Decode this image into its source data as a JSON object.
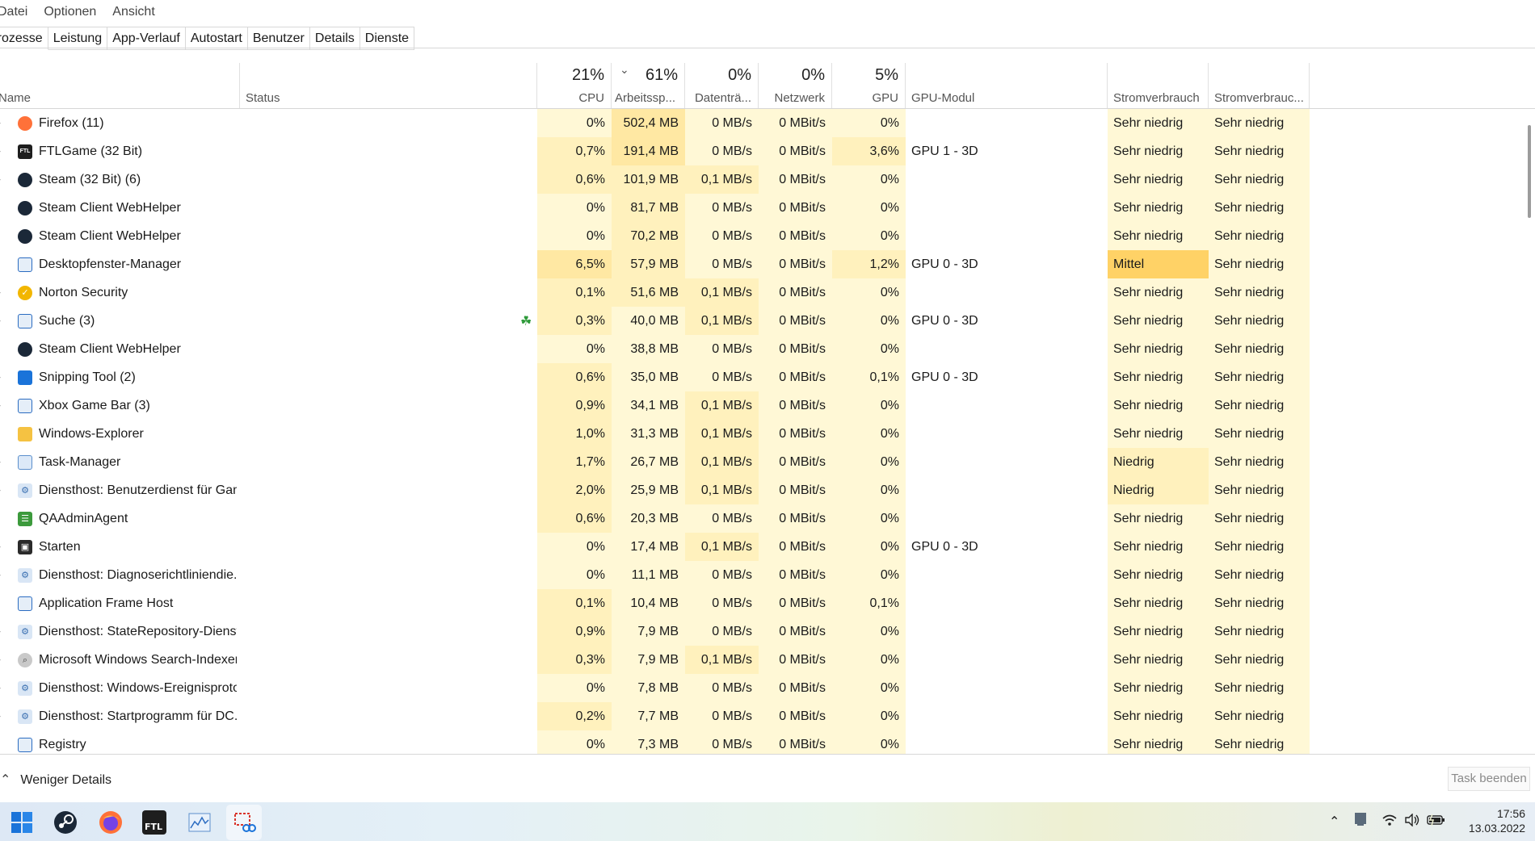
{
  "menu": [
    "Datei",
    "Optionen",
    "Ansicht"
  ],
  "tabs": [
    "Prozesse",
    "Leistung",
    "App-Verlauf",
    "Autostart",
    "Benutzer",
    "Details",
    "Dienste"
  ],
  "header": {
    "name": "Name",
    "status": "Status",
    "cpu_pct": "21%",
    "cpu": "CPU",
    "mem_pct": "61%",
    "mem": "Arbeitssp...",
    "disk_pct": "0%",
    "disk": "Datenträ...",
    "net_pct": "0%",
    "net": "Netzwerk",
    "gpu_pct": "5%",
    "gpu": "GPU",
    "gpu_engine": "GPU-Modul",
    "power": "Stromverbrauch",
    "power_trend": "Stromverbrauc..."
  },
  "processes": [
    {
      "name": "Firefox (11)",
      "icon": "firefox-icon",
      "expand": true,
      "cpu": "0%",
      "mem": "502,4 MB",
      "disk": "0 MB/s",
      "net": "0 MBit/s",
      "gpu": "0%",
      "engine": "",
      "power": "Sehr niedrig",
      "trend": "Sehr niedrig"
    },
    {
      "name": "FTLGame (32 Bit)",
      "icon": "ftl-icon",
      "expand": true,
      "cpu": "0,7%",
      "mem": "191,4 MB",
      "disk": "0 MB/s",
      "net": "0 MBit/s",
      "gpu": "3,6%",
      "engine": "GPU 1 - 3D",
      "power": "Sehr niedrig",
      "trend": "Sehr niedrig"
    },
    {
      "name": "Steam (32 Bit) (6)",
      "icon": "steam-icon",
      "expand": true,
      "cpu": "0,6%",
      "mem": "101,9 MB",
      "disk": "0,1 MB/s",
      "net": "0 MBit/s",
      "gpu": "0%",
      "engine": "",
      "power": "Sehr niedrig",
      "trend": "Sehr niedrig"
    },
    {
      "name": "Steam Client WebHelper",
      "icon": "steam-icon",
      "expand": false,
      "cpu": "0%",
      "mem": "81,7 MB",
      "disk": "0 MB/s",
      "net": "0 MBit/s",
      "gpu": "0%",
      "engine": "",
      "power": "Sehr niedrig",
      "trend": "Sehr niedrig"
    },
    {
      "name": "Steam Client WebHelper",
      "icon": "steam-icon",
      "expand": false,
      "cpu": "0%",
      "mem": "70,2 MB",
      "disk": "0 MB/s",
      "net": "0 MBit/s",
      "gpu": "0%",
      "engine": "",
      "power": "Sehr niedrig",
      "trend": "Sehr niedrig"
    },
    {
      "name": "Desktopfenster-Manager",
      "icon": "window-icon",
      "expand": false,
      "cpu": "6,5%",
      "mem": "57,9 MB",
      "disk": "0 MB/s",
      "net": "0 MBit/s",
      "gpu": "1,2%",
      "engine": "GPU 0 - 3D",
      "power": "Mittel",
      "trend": "Sehr niedrig"
    },
    {
      "name": "Norton Security",
      "icon": "norton-icon",
      "expand": true,
      "cpu": "0,1%",
      "mem": "51,6 MB",
      "disk": "0,1 MB/s",
      "net": "0 MBit/s",
      "gpu": "0%",
      "engine": "",
      "power": "Sehr niedrig",
      "trend": "Sehr niedrig"
    },
    {
      "name": "Suche (3)",
      "icon": "window-icon",
      "expand": true,
      "leaf": true,
      "cpu": "0,3%",
      "mem": "40,0 MB",
      "disk": "0,1 MB/s",
      "net": "0 MBit/s",
      "gpu": "0%",
      "engine": "GPU 0 - 3D",
      "power": "Sehr niedrig",
      "trend": "Sehr niedrig"
    },
    {
      "name": "Steam Client WebHelper",
      "icon": "steam-icon",
      "expand": false,
      "cpu": "0%",
      "mem": "38,8 MB",
      "disk": "0 MB/s",
      "net": "0 MBit/s",
      "gpu": "0%",
      "engine": "",
      "power": "Sehr niedrig",
      "trend": "Sehr niedrig"
    },
    {
      "name": "Snipping Tool (2)",
      "icon": "snipping-icon",
      "expand": true,
      "cpu": "0,6%",
      "mem": "35,0 MB",
      "disk": "0 MB/s",
      "net": "0 MBit/s",
      "gpu": "0,1%",
      "engine": "GPU 0 - 3D",
      "power": "Sehr niedrig",
      "trend": "Sehr niedrig"
    },
    {
      "name": "Xbox Game Bar (3)",
      "icon": "window-icon",
      "expand": true,
      "cpu": "0,9%",
      "mem": "34,1 MB",
      "disk": "0,1 MB/s",
      "net": "0 MBit/s",
      "gpu": "0%",
      "engine": "",
      "power": "Sehr niedrig",
      "trend": "Sehr niedrig"
    },
    {
      "name": "Windows-Explorer",
      "icon": "folder-icon",
      "expand": false,
      "cpu": "1,0%",
      "mem": "31,3 MB",
      "disk": "0,1 MB/s",
      "net": "0 MBit/s",
      "gpu": "0%",
      "engine": "",
      "power": "Sehr niedrig",
      "trend": "Sehr niedrig"
    },
    {
      "name": "Task-Manager",
      "icon": "taskmanager-icon",
      "expand": true,
      "cpu": "1,7%",
      "mem": "26,7 MB",
      "disk": "0,1 MB/s",
      "net": "0 MBit/s",
      "gpu": "0%",
      "engine": "",
      "power": "Niedrig",
      "trend": "Sehr niedrig"
    },
    {
      "name": "Diensthost: Benutzerdienst für Gam...",
      "icon": "gear-icon",
      "expand": true,
      "cpu": "2,0%",
      "mem": "25,9 MB",
      "disk": "0,1 MB/s",
      "net": "0 MBit/s",
      "gpu": "0%",
      "engine": "",
      "power": "Niedrig",
      "trend": "Sehr niedrig"
    },
    {
      "name": "QAAdminAgent",
      "icon": "qa-icon",
      "expand": false,
      "cpu": "0,6%",
      "mem": "20,3 MB",
      "disk": "0 MB/s",
      "net": "0 MBit/s",
      "gpu": "0%",
      "engine": "",
      "power": "Sehr niedrig",
      "trend": "Sehr niedrig"
    },
    {
      "name": "Starten",
      "icon": "start-icon",
      "expand": true,
      "cpu": "0%",
      "mem": "17,4 MB",
      "disk": "0,1 MB/s",
      "net": "0 MBit/s",
      "gpu": "0%",
      "engine": "GPU 0 - 3D",
      "power": "Sehr niedrig",
      "trend": "Sehr niedrig"
    },
    {
      "name": "Diensthost: Diagnoserichtliniendie...",
      "icon": "gear-icon",
      "expand": true,
      "cpu": "0%",
      "mem": "11,1 MB",
      "disk": "0 MB/s",
      "net": "0 MBit/s",
      "gpu": "0%",
      "engine": "",
      "power": "Sehr niedrig",
      "trend": "Sehr niedrig"
    },
    {
      "name": "Application Frame Host",
      "icon": "window-icon",
      "expand": false,
      "cpu": "0,1%",
      "mem": "10,4 MB",
      "disk": "0 MB/s",
      "net": "0 MBit/s",
      "gpu": "0,1%",
      "engine": "",
      "power": "Sehr niedrig",
      "trend": "Sehr niedrig"
    },
    {
      "name": "Diensthost: StateRepository-Dienst",
      "icon": "gear-icon",
      "expand": true,
      "cpu": "0,9%",
      "mem": "7,9 MB",
      "disk": "0 MB/s",
      "net": "0 MBit/s",
      "gpu": "0%",
      "engine": "",
      "power": "Sehr niedrig",
      "trend": "Sehr niedrig"
    },
    {
      "name": "Microsoft Windows Search-Indexer...",
      "icon": "search-indexer-icon",
      "expand": true,
      "cpu": "0,3%",
      "mem": "7,9 MB",
      "disk": "0,1 MB/s",
      "net": "0 MBit/s",
      "gpu": "0%",
      "engine": "",
      "power": "Sehr niedrig",
      "trend": "Sehr niedrig"
    },
    {
      "name": "Diensthost: Windows-Ereignisproto...",
      "icon": "gear-icon",
      "expand": true,
      "cpu": "0%",
      "mem": "7,8 MB",
      "disk": "0 MB/s",
      "net": "0 MBit/s",
      "gpu": "0%",
      "engine": "",
      "power": "Sehr niedrig",
      "trend": "Sehr niedrig"
    },
    {
      "name": "Diensthost: Startprogramm für DC...",
      "icon": "gear-icon",
      "expand": true,
      "cpu": "0,2%",
      "mem": "7,7 MB",
      "disk": "0 MB/s",
      "net": "0 MBit/s",
      "gpu": "0%",
      "engine": "",
      "power": "Sehr niedrig",
      "trend": "Sehr niedrig"
    },
    {
      "name": "Registry",
      "icon": "window-icon",
      "expand": false,
      "cpu": "0%",
      "mem": "7,3 MB",
      "disk": "0 MB/s",
      "net": "0 MBit/s",
      "gpu": "0%",
      "engine": "",
      "power": "Sehr niedrig",
      "trend": "Sehr niedrig"
    }
  ],
  "footer": {
    "fewer_details": "Weniger Details",
    "end_task": "Task beenden"
  },
  "clock": {
    "time": "17:56",
    "date": "13.03.2022"
  },
  "colors": {
    "heat_light": "#fff8d6",
    "heat_mid": "#fff1bd",
    "heat_strong": "#ffe8a3",
    "heat_hot": "#ffd266"
  }
}
